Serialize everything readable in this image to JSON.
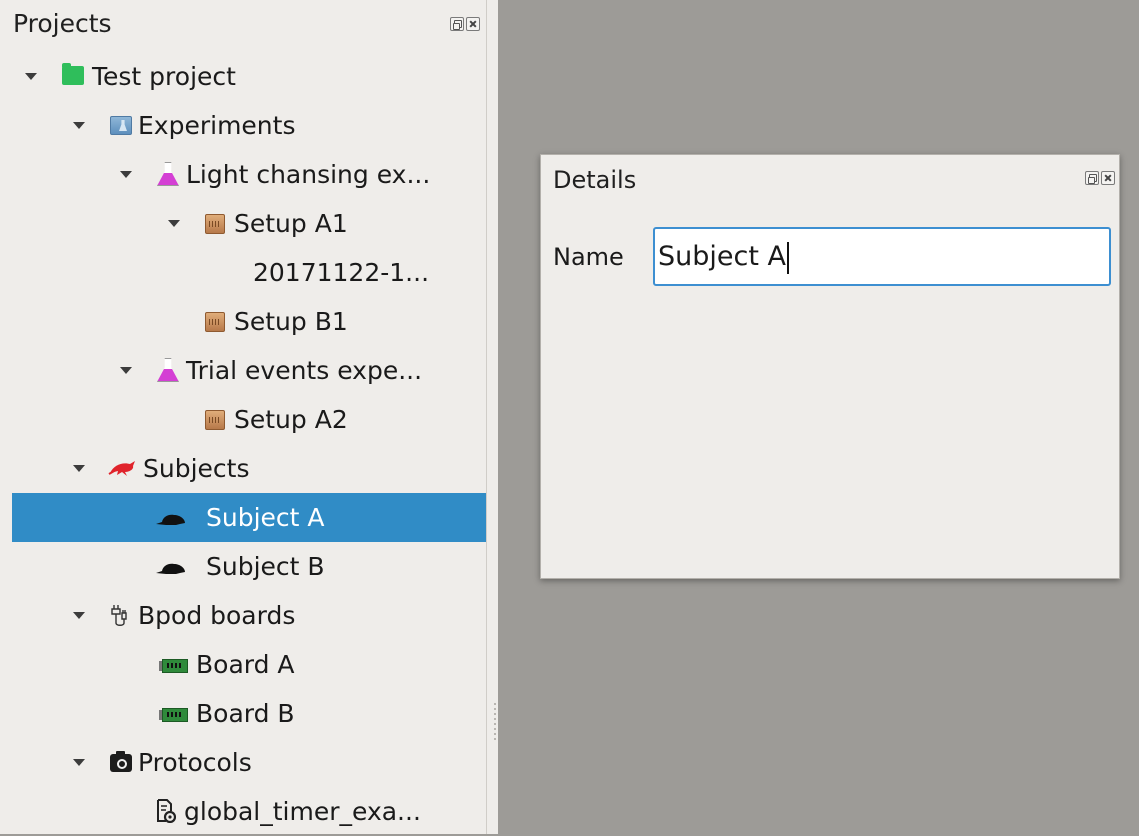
{
  "projects_dock": {
    "title": "Projects",
    "tree": [
      {
        "label": "Test project",
        "icon": "project-folder-icon",
        "expanded": true,
        "selected": false
      },
      {
        "label": "Experiments",
        "icon": "experiments-icon",
        "expanded": true,
        "selected": false
      },
      {
        "label": "Light chansing ex...",
        "icon": "flask-icon",
        "expanded": true,
        "selected": false
      },
      {
        "label": "Setup A1",
        "icon": "setup-icon",
        "expanded": true,
        "selected": false
      },
      {
        "label": "20171122-1...",
        "icon": "",
        "expanded": false,
        "selected": false
      },
      {
        "label": "Setup B1",
        "icon": "setup-icon",
        "expanded": false,
        "selected": false
      },
      {
        "label": "Trial events expe...",
        "icon": "flask-icon",
        "expanded": true,
        "selected": false
      },
      {
        "label": "Setup A2",
        "icon": "setup-icon",
        "expanded": false,
        "selected": false
      },
      {
        "label": "Subjects",
        "icon": "subjects-rat-icon",
        "expanded": true,
        "selected": false
      },
      {
        "label": "Subject A",
        "icon": "mouse-icon",
        "expanded": false,
        "selected": true
      },
      {
        "label": "Subject B",
        "icon": "mouse-icon",
        "expanded": false,
        "selected": false
      },
      {
        "label": "Bpod boards",
        "icon": "plug-icon",
        "expanded": true,
        "selected": false
      },
      {
        "label": "Board A",
        "icon": "board-icon",
        "expanded": false,
        "selected": false
      },
      {
        "label": "Board B",
        "icon": "board-icon",
        "expanded": false,
        "selected": false
      },
      {
        "label": "Protocols",
        "icon": "camera-icon",
        "expanded": true,
        "selected": false
      },
      {
        "label": "global_timer_exa...",
        "icon": "protocol-file-icon",
        "expanded": false,
        "selected": false
      }
    ]
  },
  "details_dock": {
    "title": "Details",
    "name_label": "Name",
    "name_value": "Subject A"
  },
  "colors": {
    "selection": "#308cc6",
    "workspace": "#9d9b97",
    "panel": "#efedea",
    "input_focus": "#3d8fd1"
  }
}
